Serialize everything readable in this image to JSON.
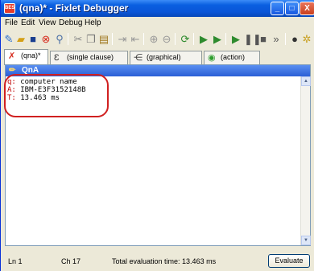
{
  "window": {
    "title": "(qna)* - Fixlet Debugger",
    "app_icon_text": "BES",
    "controls": {
      "minimize": "_",
      "maximize": "□",
      "close": "X"
    }
  },
  "menu": [
    "File",
    "Edit",
    "View",
    "Debug",
    "Help"
  ],
  "toolbar": [
    "new-icon",
    "open-icon",
    "save-icon",
    "stop-icon",
    "find-icon",
    "cut-icon",
    "copy-icon",
    "paste-icon",
    "indent-icon",
    "outdent-icon",
    "zoom-in-icon",
    "zoom-out-icon",
    "refresh-icon",
    "run-icon",
    "run-to-icon",
    "step-icon",
    "pause-icon",
    "stop-debug-icon",
    "step-over-icon",
    "breakpoint-icon",
    "clear-breakpoints-icon"
  ],
  "tabs": [
    {
      "label": "(qna)*",
      "active": true
    },
    {
      "label": "(single clause)",
      "active": false
    },
    {
      "label": "(graphical)",
      "active": false
    },
    {
      "label": "(action)",
      "active": false
    }
  ],
  "panel": {
    "title": "QnA"
  },
  "editor": {
    "lines": [
      {
        "prefix": "q:",
        "text": " computer name"
      },
      {
        "prefix": "A:",
        "text": " IBM-E3F3152148B"
      },
      {
        "prefix": "T:",
        "text": " 13.463 ms"
      }
    ]
  },
  "status": {
    "line": "Ln 1",
    "col": "Ch 17",
    "eval_time": "Total evaluation time: 13.463 ms",
    "evaluate_label": "Evaluate"
  }
}
